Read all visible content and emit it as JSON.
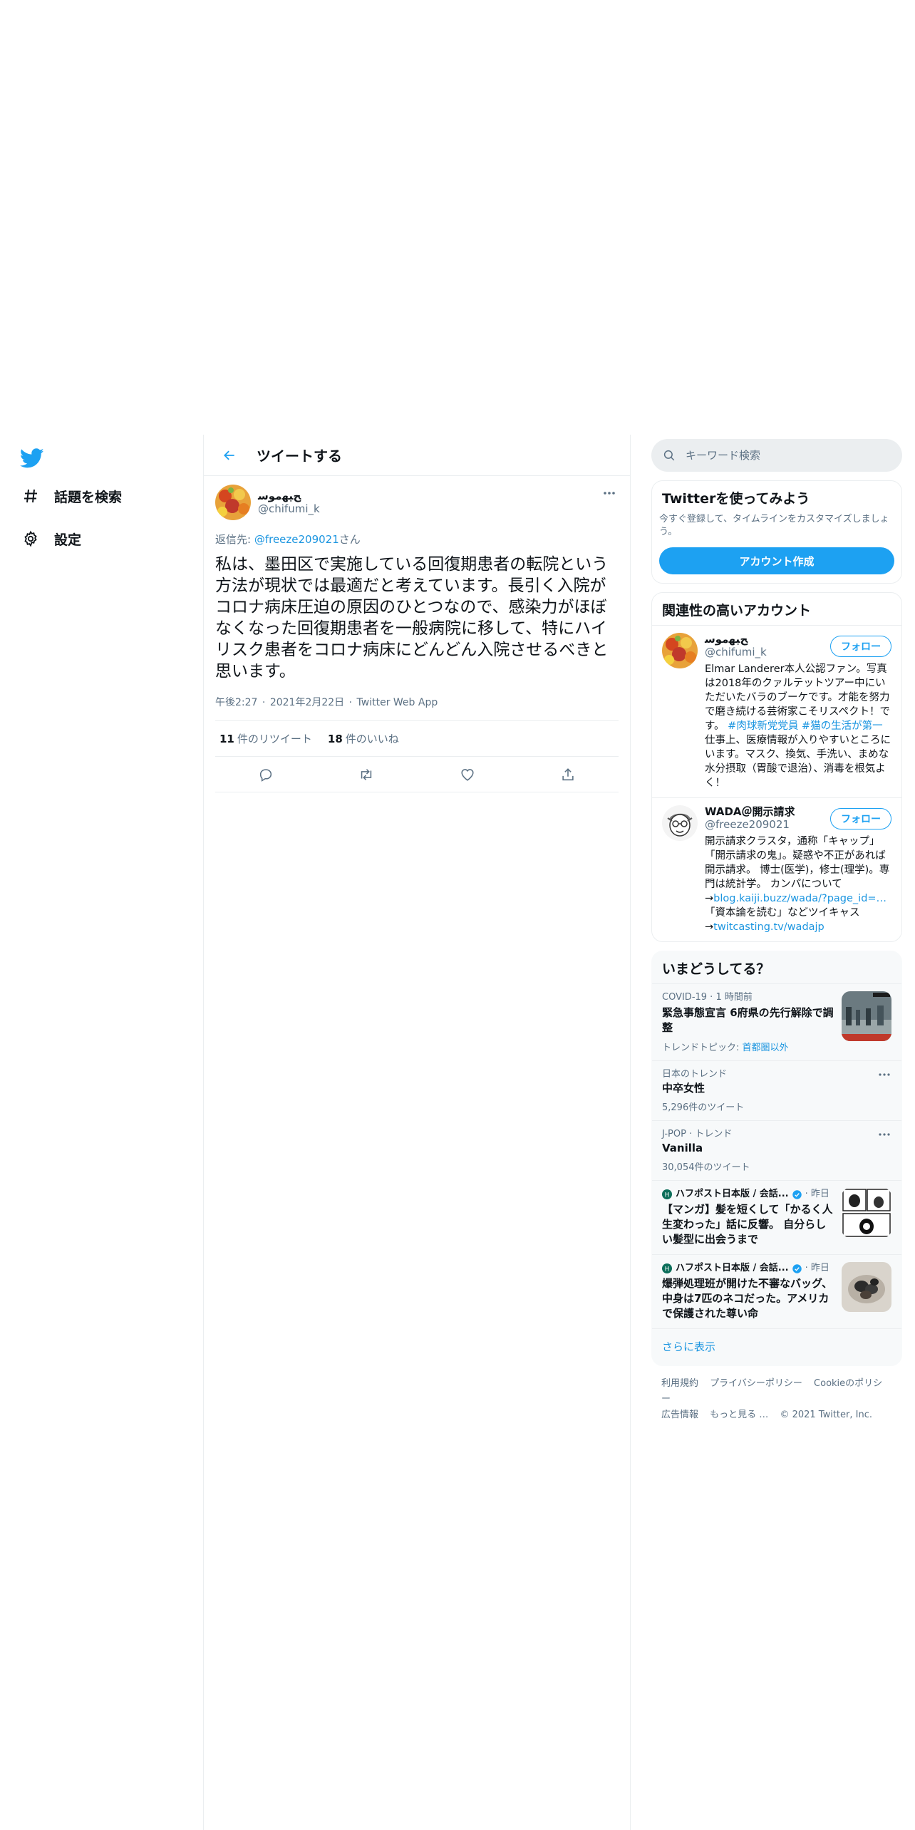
{
  "nav": {
    "logo": "twitter-bird",
    "items": [
      {
        "label": "話題を検索",
        "icon": "hashtag"
      },
      {
        "label": "設定",
        "icon": "gear"
      }
    ]
  },
  "header": {
    "title": "ツイートする"
  },
  "tweet": {
    "name": "ﺢﻴﻬﻣﻮﺳ",
    "handle": "@chifumi_k",
    "reply_prefix": "返信先: ",
    "reply_to": "@freeze209021",
    "reply_suffix": "さん",
    "text": "私は、墨田区で実施している回復期患者の転院という方法が現状では最適だと考えています。長引く入院がコロナ病床圧迫の原因のひとつなので、感染力がほぼなくなった回復期患者を一般病院に移して、特にハイリスク患者をコロナ病床にどんどん入院させるべきと思います。",
    "time": "午後2:27",
    "date": "2021年2月22日",
    "source": "Twitter Web App",
    "sep": " · ",
    "retweets": "11",
    "retweets_label": "件のリツイート",
    "likes": "18",
    "likes_label": "件のいいね"
  },
  "search": {
    "placeholder": "キーワード検索"
  },
  "signup": {
    "title": "Twitterを使ってみよう",
    "desc": "今すぐ登録して、タイムラインをカスタマイズしましょう。",
    "button": "アカウント作成"
  },
  "related": {
    "title": "関連性の高いアカウント",
    "follow_label": "フォロー",
    "accounts": [
      {
        "name": "ﺢﻴﻬﻣﻮﺳ",
        "handle": "@chifumi_k",
        "bio_pre": "Elmar Landerer本人公認ファン。写真は2018年のクァルテットツアー中にいただいたバラのブーケです。才能を努力で磨き続ける芸術家こそリスペクト！です。 ",
        "bio_tags": "#肉球新党党員 #猫の生活が第一",
        "bio_post": " 仕事上、医療情報が入りやすいところにいます。マスク、換気、手洗い、まめな水分摂取（胃酸で退治）、消毒を根気よく！"
      },
      {
        "name": "WADA＠開示請求",
        "handle": "@freeze209021",
        "bio_pre": "開示請求クラスタ，通称「キャップ」「開示請求の鬼」。疑惑や不正があれば開示請求。 博士(医学)，修士(理学)。専門は統計学。 カンパについて→",
        "bio_link1": "blog.kaiji.buzz/wada/?page_id=…",
        "bio_mid": " 「資本論を読む」などツイキャス→",
        "bio_link2": "twitcasting.tv/wadajp"
      }
    ]
  },
  "trends": {
    "title": "いまどうしてる？",
    "items": [
      {
        "meta": "COVID-19 · 1 時間前",
        "title": "緊急事態宣言 6府県の先行解除で調整",
        "sub_prefix": "トレンドトピック: ",
        "sub_link": "首都圏以外"
      },
      {
        "meta": "日本のトレンド",
        "title": "中卒女性",
        "count": "5,296件のツイート"
      },
      {
        "meta": "J-POP · トレンド",
        "title": "Vanilla",
        "count": "30,054件のツイート"
      },
      {
        "source": "ハフポスト日本版 / 会話...",
        "time": "· 昨日",
        "title": "【マンガ】髪を短くして「かるく人生変わった」話に反響。 自分らしい髪型に出会うまで"
      },
      {
        "source": "ハフポスト日本版 / 会話...",
        "time": "· 昨日",
        "title": "爆弾処理班が開けた不審なバッグ、中身は7匹のネコだった。アメリカで保護された尊い命"
      }
    ],
    "show_more": "さらに表示"
  },
  "footer": {
    "links": [
      "利用規約",
      "プライバシーポリシー",
      "Cookieのポリシー",
      "広告情報",
      "もっと見る …"
    ],
    "copyright": "© 2021 Twitter, Inc."
  },
  "colors": {
    "accent": "#1da1f2",
    "link": "#1b95e0",
    "muted": "#5b7083",
    "border": "#ebeef0"
  }
}
